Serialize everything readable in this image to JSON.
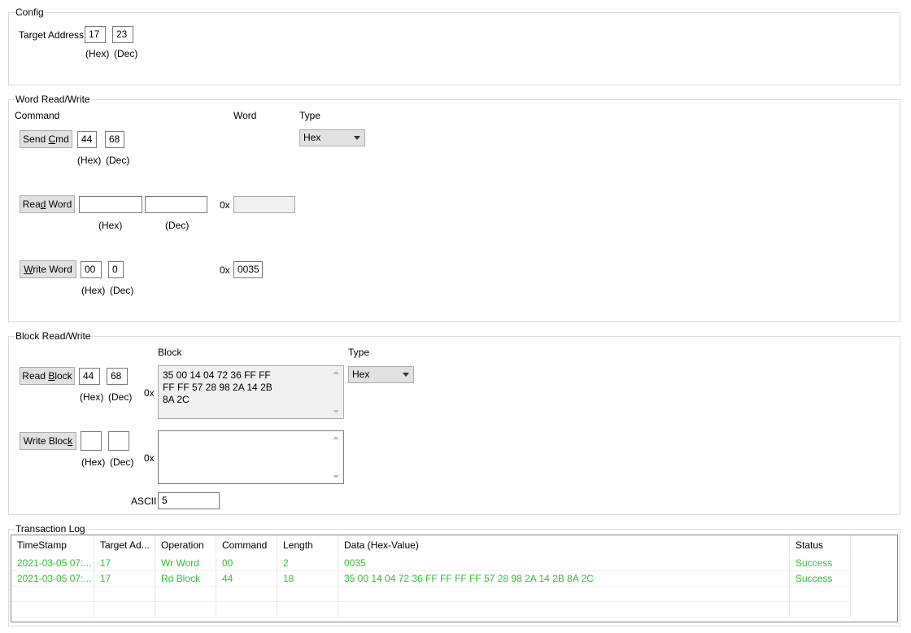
{
  "config": {
    "title": "Config",
    "target_address_label": "Target Address",
    "target_hex": "17",
    "target_dec": "23",
    "hex_label": "(Hex)",
    "dec_label": "(Dec)"
  },
  "word_rw": {
    "title": "Word Read/Write",
    "command_label": "Command",
    "word_label": "Word",
    "type_label": "Type",
    "type_value": "Hex",
    "send_cmd": {
      "pre": "Send ",
      "u": "C",
      "post": "md",
      "hex": "44",
      "dec": "68"
    },
    "read_word": {
      "pre": "Rea",
      "u": "d",
      "post": " Word",
      "hex": "",
      "dec": "",
      "prefix": "0x",
      "value": ""
    },
    "write_word": {
      "pre": "",
      "u": "W",
      "post": "rite Word",
      "hex": "00",
      "dec": "0",
      "prefix": "0x",
      "value": "0035"
    },
    "hex_label": "(Hex)",
    "dec_label": "(Dec)"
  },
  "block_rw": {
    "title": "Block Read/Write",
    "block_label": "Block",
    "type_label": "Type",
    "type_value": "Hex",
    "read_block": {
      "pre": "Read ",
      "u": "B",
      "post": "lock",
      "hex": "44",
      "dec": "68",
      "prefix": "0x",
      "lines": [
        "35 00 14 04 72 36 FF FF",
        "FF FF 57 28 98 2A 14 2B",
        "8A 2C"
      ]
    },
    "write_block": {
      "pre": "Write Bloc",
      "u": "k",
      "post": "",
      "hex": "",
      "dec": "",
      "prefix": "0x"
    },
    "hex_label": "(Hex)",
    "dec_label": "(Dec)",
    "ascii_label": "ASCII",
    "ascii_value": "5"
  },
  "log": {
    "title": "Transaction Log",
    "columns": [
      "TimeStamp",
      "Target Ad...",
      "Operation",
      "Command",
      "Length",
      "Data (Hex-Value)",
      "Status"
    ],
    "rows": [
      [
        "2021-03-05 07:...",
        "17",
        "Wr Word",
        "00",
        "2",
        "0035",
        "Success"
      ],
      [
        "2021-03-05 07:...",
        "17",
        "Rd Block",
        "44",
        "18",
        "35 00 14 04 72 36 FF FF FF FF 57 28 98 2A 14 2B 8A 2C",
        "Success"
      ]
    ],
    "success_color": "#2cc42c"
  }
}
